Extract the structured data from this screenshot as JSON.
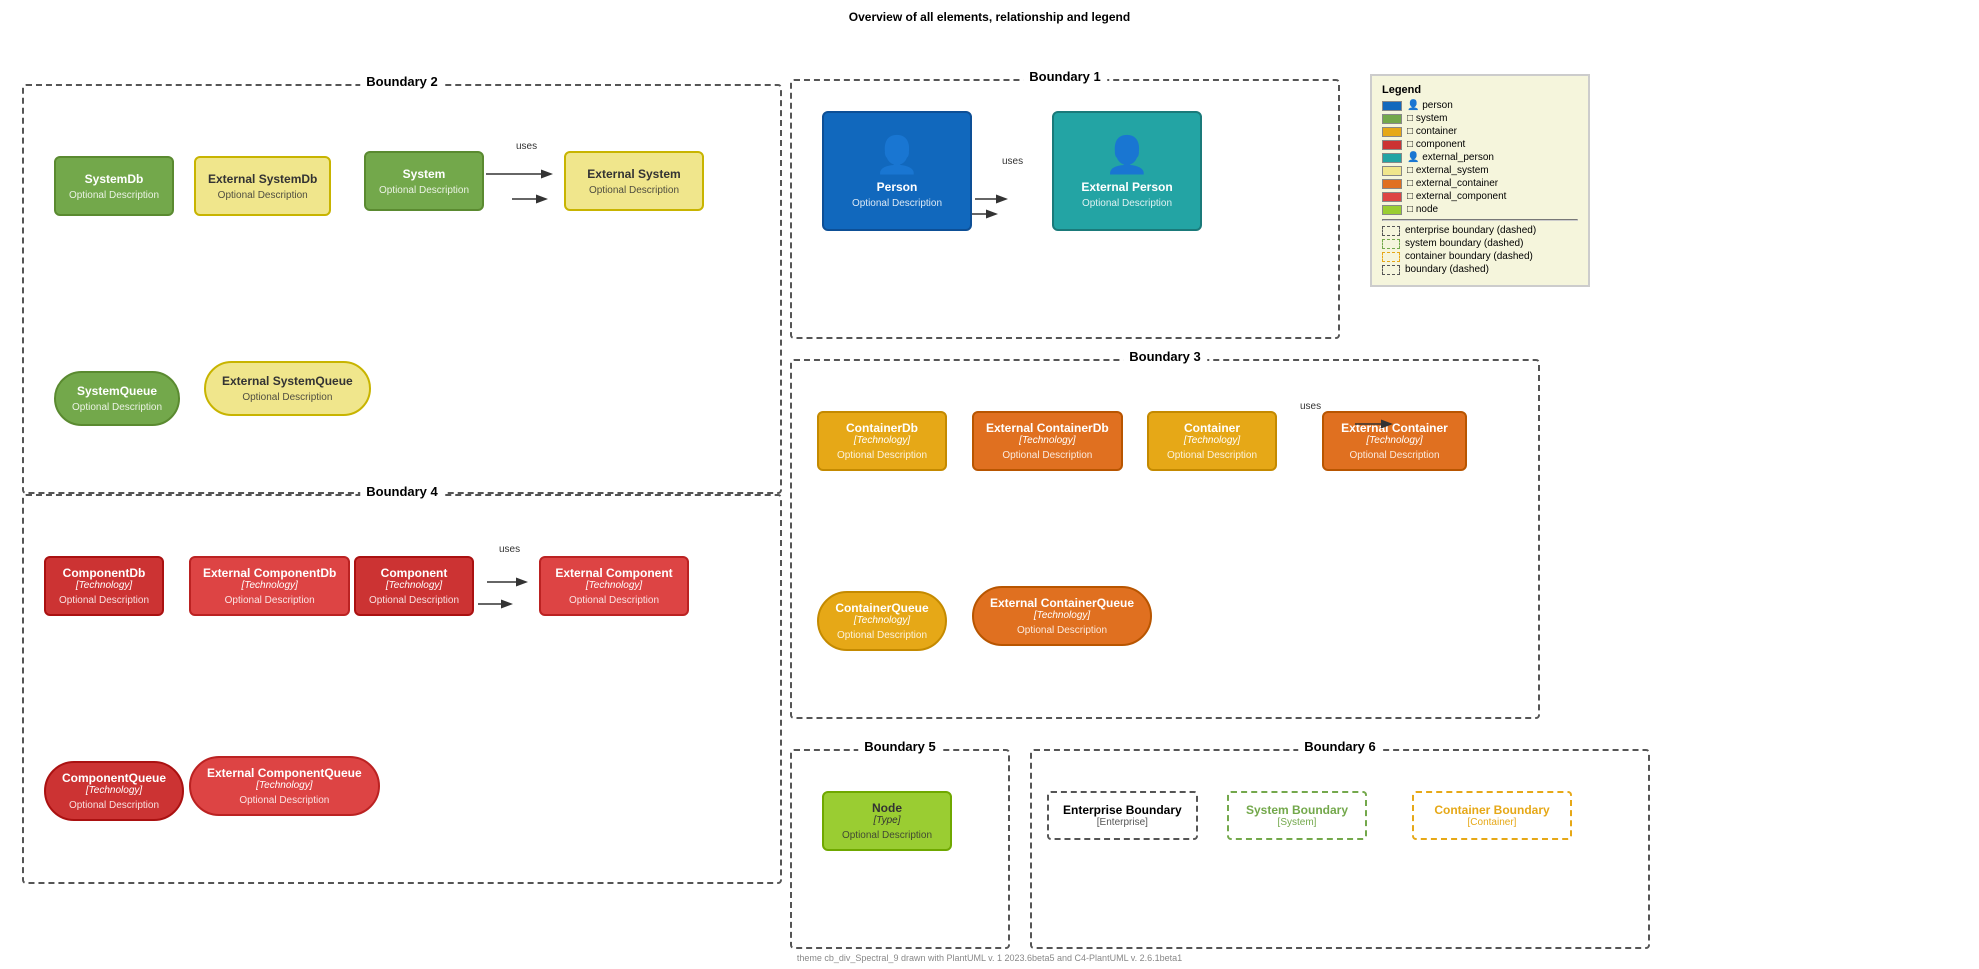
{
  "page": {
    "title": "Overview of all elements, relationship and legend",
    "footer": "theme cb_div_Spectral_9 drawn with PlantUML v. 1 2023.6beta5 and C4-PlantUML v. 2.6.1beta1"
  },
  "boundaries": {
    "b1": {
      "title": "Boundary 1"
    },
    "b2": {
      "title": "Boundary 2"
    },
    "b3": {
      "title": "Boundary 3"
    },
    "b4": {
      "title": "Boundary 4"
    },
    "b5": {
      "title": "Boundary 5"
    },
    "b6": {
      "title": "Boundary 6"
    }
  },
  "elements": {
    "systemDb": {
      "name": "SystemDb",
      "desc": "Optional Description"
    },
    "externalSystemDb": {
      "name": "External SystemDb",
      "desc": "Optional Description"
    },
    "system": {
      "name": "System",
      "desc": "Optional Description"
    },
    "externalSystem": {
      "name": "External System",
      "desc": "Optional Description"
    },
    "systemQueue": {
      "name": "SystemQueue",
      "desc": "Optional Description"
    },
    "externalSystemQueue": {
      "name": "External SystemQueue",
      "desc": "Optional Description"
    },
    "person": {
      "name": "Person",
      "desc": "Optional Description"
    },
    "externalPerson": {
      "name": "External Person",
      "desc": "Optional Description"
    },
    "containerDb": {
      "name": "ContainerDb",
      "tech": "[Technology]",
      "desc": "Optional Description"
    },
    "externalContainerDb": {
      "name": "External ContainerDb",
      "tech": "[Technology]",
      "desc": "Optional Description"
    },
    "container": {
      "name": "Container",
      "tech": "[Technology]",
      "desc": "Optional Description"
    },
    "externalContainer": {
      "name": "External Container",
      "tech": "[Technology]",
      "desc": "Optional Description"
    },
    "containerQueue": {
      "name": "ContainerQueue",
      "tech": "[Technology]",
      "desc": "Optional Description"
    },
    "externalContainerQueue": {
      "name": "External ContainerQueue",
      "tech": "[Technology]",
      "desc": "Optional Description"
    },
    "componentDb": {
      "name": "ComponentDb",
      "tech": "[Technology]",
      "desc": "Optional Description"
    },
    "externalComponentDb": {
      "name": "External ComponentDb",
      "tech": "[Technology]",
      "desc": "Optional Description"
    },
    "component": {
      "name": "Component",
      "tech": "[Technology]",
      "desc": "Optional Description"
    },
    "externalComponent": {
      "name": "External Component",
      "tech": "[Technology]",
      "desc": "Optional Description"
    },
    "componentQueue": {
      "name": "ComponentQueue",
      "tech": "[Technology]",
      "desc": "Optional Description"
    },
    "externalComponentQueue": {
      "name": "External ComponentQueue",
      "tech": "[Technology]",
      "desc": "Optional Description"
    },
    "node": {
      "name": "Node",
      "tech": "[Type]",
      "desc": "Optional Description"
    },
    "enterpriseBoundary": {
      "name": "Enterprise Boundary",
      "sub": "[Enterprise]"
    },
    "systemBoundary": {
      "name": "System Boundary",
      "sub": "[System]"
    },
    "containerBoundary": {
      "name": "Container Boundary",
      "sub": "[Container]"
    }
  },
  "relations": {
    "uses": "uses"
  },
  "legend": {
    "title": "Legend",
    "items": [
      {
        "label": "person",
        "color": "#1168bd"
      },
      {
        "label": "system",
        "color": "#73a84b"
      },
      {
        "label": "container",
        "color": "#e6a817"
      },
      {
        "label": "component",
        "color": "#cc3333"
      },
      {
        "label": "external_person",
        "color": "#23a4a4"
      },
      {
        "label": "external_system",
        "color": "#f0e68c"
      },
      {
        "label": "external_container",
        "color": "#e07020"
      },
      {
        "label": "external_component",
        "color": "#dd4444"
      },
      {
        "label": "node",
        "color": "#9acd32"
      }
    ],
    "dashed": [
      {
        "label": "enterprise boundary (dashed)",
        "color": "#555"
      },
      {
        "label": "system boundary (dashed)",
        "color": "#73a84b"
      },
      {
        "label": "container boundary (dashed)",
        "color": "#e6a817"
      },
      {
        "label": "boundary (dashed)",
        "color": "#555"
      }
    ]
  }
}
